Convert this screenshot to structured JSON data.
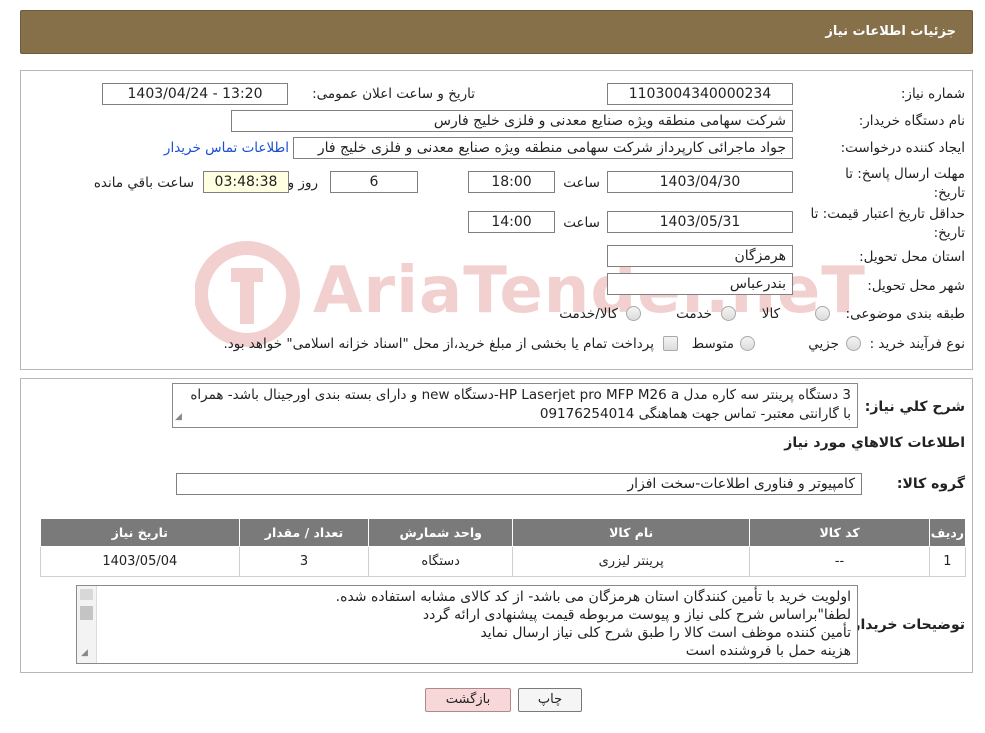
{
  "header": {
    "title": "جزئیات اطلاعات نیاز"
  },
  "form": {
    "need_number_label": "شماره نیاز:",
    "need_number": "1103004340000234",
    "announce_label": "تاریخ و ساعت اعلان عمومی:",
    "announce_value": "1403/04/24 - 13:20",
    "buyer_org_label": "نام دستگاه خریدار:",
    "buyer_org": "شرکت سهامی منطقه ویژه صنایع معدنی و فلزی خلیج فارس",
    "creator_label": "ایجاد کننده درخواست:",
    "creator": "جواد ماجرائی کارپرداز شرکت سهامی منطقه ویژه صنایع معدنی و فلزی خلیج فار",
    "contact_link": "اطلاعات تماس خریدار",
    "deadline_label_1": "مهلت ارسال پاسخ: تا",
    "deadline_label_2": "تاریخ:",
    "deadline_date": "1403/04/30",
    "time_label": "ساعت",
    "deadline_time": "18:00",
    "days_value": "6",
    "days_label": "روز و",
    "remaining_time": "03:48:38",
    "remaining_label": "ساعت باقي مانده",
    "validity_label_1": "حداقل تاریخ اعتبار قیمت: تا",
    "validity_label_2": "تاریخ:",
    "validity_date": "1403/05/31",
    "validity_time": "14:00",
    "province_label": "استان محل تحویل:",
    "province": "هرمزگان",
    "city_label": "شهر محل تحویل:",
    "city": "بندرعباس",
    "category_label": "طبقه بندی موضوعی:",
    "category_options": [
      "کالا",
      "خدمت",
      "کالا/خدمت"
    ],
    "process_label": "نوع فرآیند خرید :",
    "process_options": [
      "جزيي",
      "متوسط"
    ],
    "process_note": "پرداخت تمام یا بخشی از مبلغ خرید،از محل \"اسناد خزانه اسلامی\" خواهد بود."
  },
  "description": {
    "label": "شرح كلي نياز:",
    "text": "3 دستگاه پرینتر سه کاره مدل HP Laserjet pro MFP M26 a-دستگاه new و دارای بسته بندی اورجینال باشد- همراه با گارانتی معتبر- تماس جهت هماهنگی 09176254014"
  },
  "goods": {
    "section_title": "اطلاعات كالاهاي مورد نياز",
    "group_label": "گروه كالا:",
    "group_value": "کامپیوتر و فناوری اطلاعات-سخت افزار",
    "columns": [
      "رديف",
      "کد کالا",
      "نام کالا",
      "واحد شمارش",
      "تعداد / مقدار",
      "تاریخ نیاز"
    ],
    "rows": [
      [
        "1",
        "--",
        "پرینتر لیزری",
        "دستگاه",
        "3",
        "1403/05/04"
      ]
    ]
  },
  "buyer_notes": {
    "label": "توضیحات خریدار:",
    "lines": [
      "اولویت خرید با تأمین کنندگان استان هرمزگان می باشد- از کد کالای مشابه استفاده شده.",
      "لطفا\"براساس شرح کلی نیاز و پیوست مربوطه قیمت پیشنهادی ارائه گردد",
      "تأمین کننده موظف است کالا را طبق شرح کلی نیاز ارسال نماید",
      "هزینه حمل با فروشنده است"
    ]
  },
  "buttons": {
    "print": "چاپ",
    "back": "بازگشت"
  },
  "watermark": {
    "text": "AriaTender.neT"
  },
  "colors": {
    "header_bg": "#85704a",
    "back_button_bg": "#f7d7d7",
    "print_button_bg": "#f5f5f5",
    "watermark": "#c9302c"
  }
}
